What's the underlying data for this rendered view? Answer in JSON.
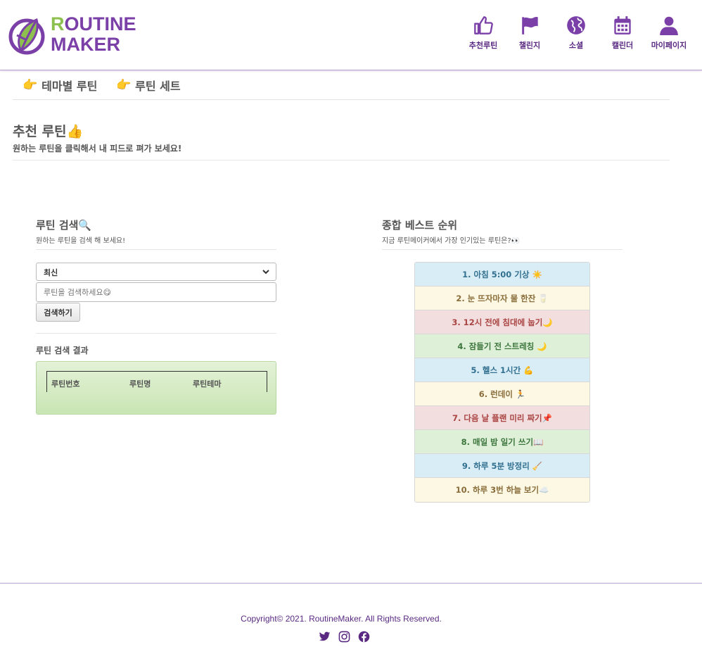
{
  "brand": {
    "logo_text_line1": "ROUTINE",
    "logo_text_line2": "MAKER",
    "accent": "#7b3fa8",
    "leaf_green": "#8dc04f"
  },
  "nav": [
    {
      "label": "추천루틴",
      "icon": "thumbs-up-icon"
    },
    {
      "label": "챌린지",
      "icon": "flag-icon"
    },
    {
      "label": "소셜",
      "icon": "globe-icon"
    },
    {
      "label": "캘린더",
      "icon": "calendar-icon"
    },
    {
      "label": "마이페이지",
      "icon": "user-icon"
    }
  ],
  "subnav": [
    {
      "label": "테마별 루틴",
      "icon": "pointing-hand-icon"
    },
    {
      "label": "루틴 세트",
      "icon": "pointing-hand-icon"
    }
  ],
  "page": {
    "title": "추천 루틴👍",
    "subtitle": "원하는 루틴을 클릭해서 내 피드로 펴가 보세요!"
  },
  "search": {
    "title": "루틴 검색🔍",
    "subtitle": "원하는 루틴을 검색 해 보세요!",
    "sort_selected": "최신",
    "placeholder": "루틴을 검색하세요😋",
    "button_label": "검색하기",
    "result_label": "루틴 검색 결과",
    "columns": [
      "루틴번호",
      "루틴명",
      "루틴테마"
    ]
  },
  "ranking": {
    "title": "종합 베스트 순위",
    "subtitle": "지금 루틴메이커에서 가장 인기있는 루틴은?👀",
    "items": [
      {
        "text": "1. 아침 5:00 기상 ☀️",
        "style": "info"
      },
      {
        "text": "2. 눈 뜨자마자 물 한잔 🥛",
        "style": "warning"
      },
      {
        "text": "3. 12시 전에 침대에 눕기🌙",
        "style": "danger"
      },
      {
        "text": "4. 잠들기 전 스트레칭 🌙",
        "style": "success"
      },
      {
        "text": "5. 헬스 1시간 💪",
        "style": "info"
      },
      {
        "text": "6. 런데이 🏃",
        "style": "warning"
      },
      {
        "text": "7. 다음 날 플랜 미리 짜기📌",
        "style": "danger"
      },
      {
        "text": "8. 매일 밤 일기 쓰기📖",
        "style": "success"
      },
      {
        "text": "9. 하루 5분 방정리 🧹",
        "style": "info"
      },
      {
        "text": "10. 하루 3번 하늘 보기☁️",
        "style": "warning"
      }
    ]
  },
  "footer": {
    "copyright": "Copyright© 2021. RoutineMaker. All Rights Reserved.",
    "social": [
      "twitter-icon",
      "instagram-icon",
      "facebook-icon"
    ]
  }
}
